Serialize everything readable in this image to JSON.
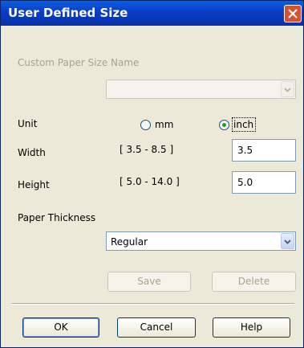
{
  "window": {
    "title": "User Defined Size"
  },
  "custom_name": {
    "label": "Custom Paper Size Name",
    "value": ""
  },
  "unit": {
    "label": "Unit",
    "options": [
      "mm",
      "inch"
    ],
    "selected": "inch"
  },
  "width": {
    "label": "Width",
    "range": "[ 3.5 - 8.5 ]",
    "value": "3.5"
  },
  "height": {
    "label": "Height",
    "range": "[ 5.0 - 14.0 ]",
    "value": "5.0"
  },
  "thickness": {
    "label": "Paper Thickness",
    "value": "Regular"
  },
  "buttons": {
    "save": "Save",
    "delete": "Delete",
    "ok": "OK",
    "cancel": "Cancel",
    "help": "Help"
  },
  "colors": {
    "titlebar": "#0a3cc8",
    "close": "#d9502e",
    "radio_selected": "#21a121"
  },
  "icons": {
    "close": "close-icon",
    "dropdown": "chevron-down-icon"
  }
}
